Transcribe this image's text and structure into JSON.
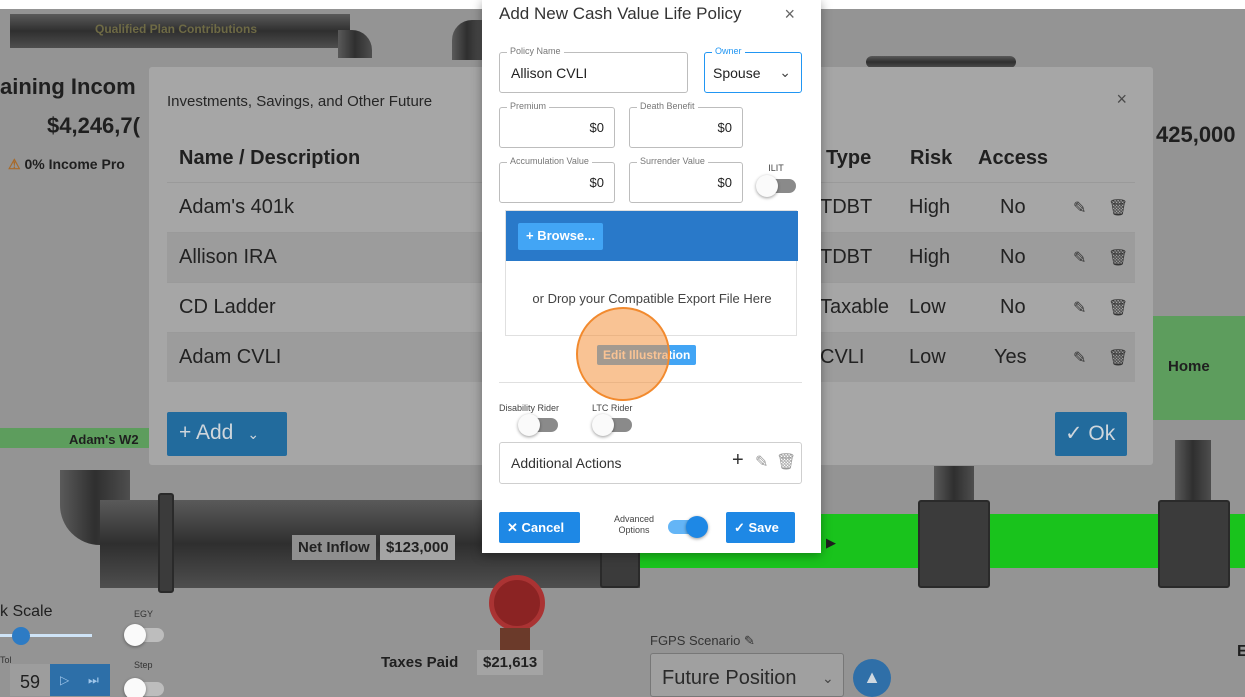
{
  "background": {
    "qualified_plan_label": "Qualified Plan Contributions",
    "remaining_income_label": "aining Incom",
    "remaining_income_value": "$4,246,7(",
    "income_protection_text": "0% Income Pro",
    "right_value": "425,000",
    "adams_w2": "Adam's W2",
    "home_label": "Home",
    "net_inflow_label": "Net Inflow",
    "net_inflow_value": "$123,000",
    "taxes_paid_label": "Taxes Paid",
    "taxes_paid_value": "$21,613",
    "k_scale_label": "k Scale",
    "egy_label": "EGY",
    "step_label": "Step",
    "year_value": "59",
    "fgps_label": "FGPS Scenario",
    "fgps_value": "Future Position",
    "edge_letter": "E",
    "tol_label": "Tol"
  },
  "investments_modal": {
    "title": "Investments, Savings, and Other Future",
    "close": "×",
    "headers": {
      "name": "Name / Description",
      "type": "Type",
      "risk": "Risk",
      "access": "Access"
    },
    "rows": [
      {
        "name": "Adam's 401k",
        "type": "TDBT",
        "risk": "High",
        "access": "No"
      },
      {
        "name": "Allison IRA",
        "type": "TDBT",
        "risk": "High",
        "access": "No"
      },
      {
        "name": "CD Ladder",
        "type": "Taxable",
        "risk": "Low",
        "access": "No"
      },
      {
        "name": "Adam CVLI",
        "type": "CVLI",
        "risk": "Low",
        "access": "Yes"
      }
    ],
    "add_label": "+ Add",
    "ok_label": "✓ Ok"
  },
  "dialog": {
    "title": "Add New Cash Value Life Policy",
    "close": "×",
    "policy_name": {
      "label": "Policy Name",
      "value": "Allison CVLI"
    },
    "owner": {
      "label": "Owner",
      "value": "Spouse"
    },
    "premium": {
      "label": "Premium",
      "value": "$0"
    },
    "death_benefit": {
      "label": "Death Benefit",
      "value": "$0"
    },
    "accumulation_value": {
      "label": "Accumulation Value",
      "value": "$0"
    },
    "surrender_value": {
      "label": "Surrender Value",
      "value": "$0"
    },
    "ilit_label": "ILIT",
    "browse_label": "+ Browse...",
    "drop_text": "or Drop your Compatible Export File Here",
    "edit_illustration": "Edit Illustration",
    "disability_rider": "Disability Rider",
    "ltc_rider": "LTC Rider",
    "additional_actions": "Additional Actions",
    "cancel_label": "✕ Cancel",
    "advanced_options": "Advanced Options",
    "save_label": "✓ Save",
    "toggles": {
      "ilit": false,
      "disability_rider": false,
      "ltc_rider": false,
      "advanced_options": true
    }
  },
  "colors": {
    "primary": "#1e88e5",
    "highlight": "#f28a2e",
    "pipe_green": "#19c31c"
  }
}
